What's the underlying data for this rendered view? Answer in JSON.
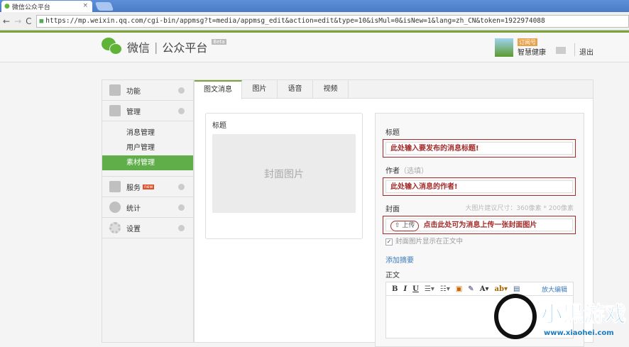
{
  "browser": {
    "tab_title": "微信公众平台",
    "url": "https://mp.weixin.qq.com/cgi-bin/appmsg?t=media/appmsg_edit&action=edit&type=10&isMul=0&isNew=1&lang=zh_CN&token=1922974088"
  },
  "header": {
    "logo_text": "微信",
    "platform": "公众平台",
    "beta": "Beta",
    "account_badge": "订阅号",
    "account_name": "智慧健康",
    "logout": "退出"
  },
  "sidebar": {
    "items": [
      {
        "label": "功能",
        "icon": "grid-icon"
      },
      {
        "label": "管理",
        "icon": "inbox-icon"
      },
      {
        "label": "服务",
        "icon": "printer-icon",
        "badge": "new"
      },
      {
        "label": "统计",
        "icon": "pie-chart-icon"
      },
      {
        "label": "设置",
        "icon": "gear-icon"
      }
    ],
    "sub_items": [
      "消息管理",
      "用户管理",
      "素材管理"
    ],
    "active_sub": "素材管理"
  },
  "tabs": [
    "图文消息",
    "图片",
    "语音",
    "视频"
  ],
  "preview": {
    "title": "标题",
    "cover": "封面图片"
  },
  "editor": {
    "title_label": "标题",
    "title_value": "此处输入要发布的消息标题!",
    "author_label": "作者",
    "author_optional": "（选填）",
    "author_value": "此处输入消息的作者!",
    "cover_label": "封面",
    "cover_hint": "大图片建议尺寸：360像素 * 200像素",
    "upload": "上传",
    "upload_note": "点击此处可为消息上传一张封面图片",
    "show_cover": "封面图片显示在正文中",
    "show_cover_checked": true,
    "add_summary": "添加摘要",
    "body_label": "正文",
    "toolbar": [
      "B",
      "I",
      "U",
      "☰▾",
      "☷▾",
      "▣",
      "✎",
      "A▾",
      "ab▾",
      "▤"
    ],
    "fullscreen": "放大编辑"
  },
  "watermark": {
    "text": "小黑游戏",
    "url": "www.xiaohei.com"
  }
}
